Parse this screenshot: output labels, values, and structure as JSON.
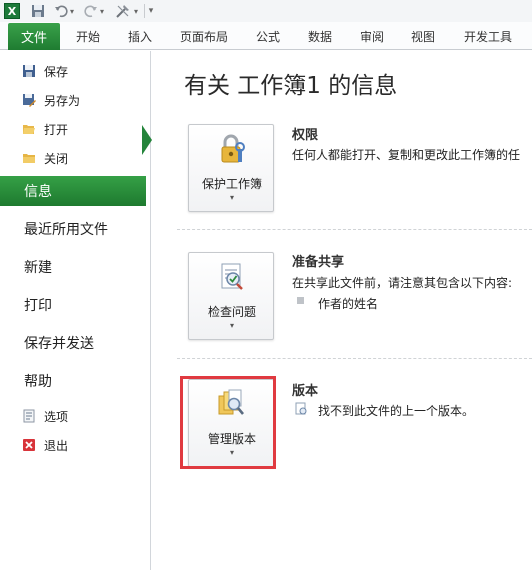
{
  "app": {
    "logo": "X"
  },
  "qat": {
    "icons": [
      "save-icon",
      "undo-icon",
      "redo-icon",
      "tools-icon",
      "customize-qat-icon"
    ],
    "dropdown_glyph": "▾"
  },
  "ribbon": {
    "file_tab": "文件",
    "tabs": [
      "开始",
      "插入",
      "页面布局",
      "公式",
      "数据",
      "审阅",
      "视图",
      "开发工具"
    ]
  },
  "sidebar": {
    "commands_top": [
      {
        "label": "保存",
        "icon": "save-icon"
      },
      {
        "label": "另存为",
        "icon": "save-as-icon"
      },
      {
        "label": "打开",
        "icon": "open-folder-icon"
      },
      {
        "label": "关闭",
        "icon": "close-folder-icon"
      }
    ],
    "nav": [
      "信息",
      "最近所用文件",
      "新建",
      "打印",
      "保存并发送",
      "帮助"
    ],
    "selected": "信息",
    "commands_bottom": [
      {
        "label": "选项",
        "icon": "options-icon"
      },
      {
        "label": "退出",
        "icon": "exit-icon"
      }
    ]
  },
  "main": {
    "title": "有关 工作簿1 的信息",
    "sections": [
      {
        "button": "保护工作簿",
        "icon": "lock-key-icon",
        "heading": "权限",
        "text": "任何人都能打开、复制和更改此工作簿的任"
      },
      {
        "button": "检查问题",
        "icon": "inspect-document-icon",
        "heading": "准备共享",
        "text": "在共享此文件前，请注意其包含以下内容:",
        "bullet": "作者的姓名"
      },
      {
        "button": "管理版本",
        "icon": "manage-versions-icon",
        "heading": "版本",
        "text": "找不到此文件的上一个版本。"
      }
    ],
    "caret": "▾",
    "highlight_color": "#e03a40"
  },
  "colors": {
    "accent": "#24843a"
  }
}
